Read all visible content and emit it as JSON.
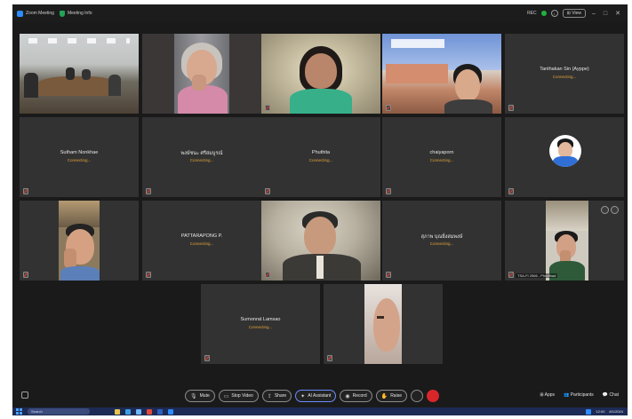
{
  "titlebar": {
    "app_label": "Zoom Meeting",
    "meeting_info_label": "Meeting Info",
    "recording_label": "REC",
    "view_label": "View",
    "minimize_glyph": "–",
    "maximize_glyph": "□",
    "close_glyph": "✕",
    "icons": [
      "zoom-logo",
      "shield-icon",
      "record-indicator",
      "info-icon"
    ]
  },
  "tiles": [
    {
      "kind": "video",
      "scene": "conference-room"
    },
    {
      "kind": "video",
      "scene": "elderly-woman"
    },
    {
      "kind": "video",
      "scene": "woman-green",
      "label": ""
    },
    {
      "kind": "video",
      "scene": "man-building",
      "label": ""
    },
    {
      "kind": "name",
      "name": "Tanthakan Sin (Ayppe)",
      "status": "Connecting..."
    },
    {
      "kind": "name",
      "name": "Sutham Nonkhae",
      "status": "Connecting..."
    },
    {
      "kind": "name",
      "name": "พงษ์ชนะ ศรีสมบูรณ์",
      "status": "Connecting..."
    },
    {
      "kind": "name",
      "name": "Phuthita",
      "status": "Connecting..."
    },
    {
      "kind": "name",
      "name": "chaiyaporn",
      "status": "Connecting..."
    },
    {
      "kind": "avatar",
      "scene": "avatar-man"
    },
    {
      "kind": "video",
      "scene": "man-hand"
    },
    {
      "kind": "name",
      "name": "PATTARAPONG P.",
      "status": "Connecting..."
    },
    {
      "kind": "video",
      "scene": "man-suit"
    },
    {
      "kind": "name",
      "name": "สุภาพ บุณยิ่งสมพงษ์",
      "status": "Connecting..."
    },
    {
      "kind": "video",
      "scene": "person-praying",
      "label": "TSA-FI 2566 - Phudthad"
    },
    {
      "kind": "name",
      "name": "Sumonrat Lamsao",
      "status": "Connecting..."
    },
    {
      "kind": "video",
      "scene": "closeup-face"
    }
  ],
  "toolbar": {
    "buttons": [
      {
        "icon": "mic-icon",
        "label": "Mute"
      },
      {
        "icon": "video-icon",
        "label": "Stop Video"
      },
      {
        "icon": "share-icon",
        "label": "Share"
      },
      {
        "icon": "ai-icon",
        "label": "AI Assistant"
      },
      {
        "icon": "record-icon",
        "label": "Record"
      },
      {
        "icon": "hand-icon",
        "label": "Raise"
      }
    ],
    "right": [
      {
        "icon": "apps-icon",
        "label": "Apps"
      },
      {
        "icon": "participants-icon",
        "label": "Participants"
      },
      {
        "icon": "chat-icon",
        "label": "Chat"
      }
    ],
    "end_color": "#d9262b"
  },
  "taskbar": {
    "search_placeholder": "Search",
    "time": "12:00",
    "date": "8/1/2024"
  },
  "colors": {
    "accent_status": "#e0a23a",
    "zoom_blue": "#2d8cff",
    "end_red": "#d9262b"
  }
}
